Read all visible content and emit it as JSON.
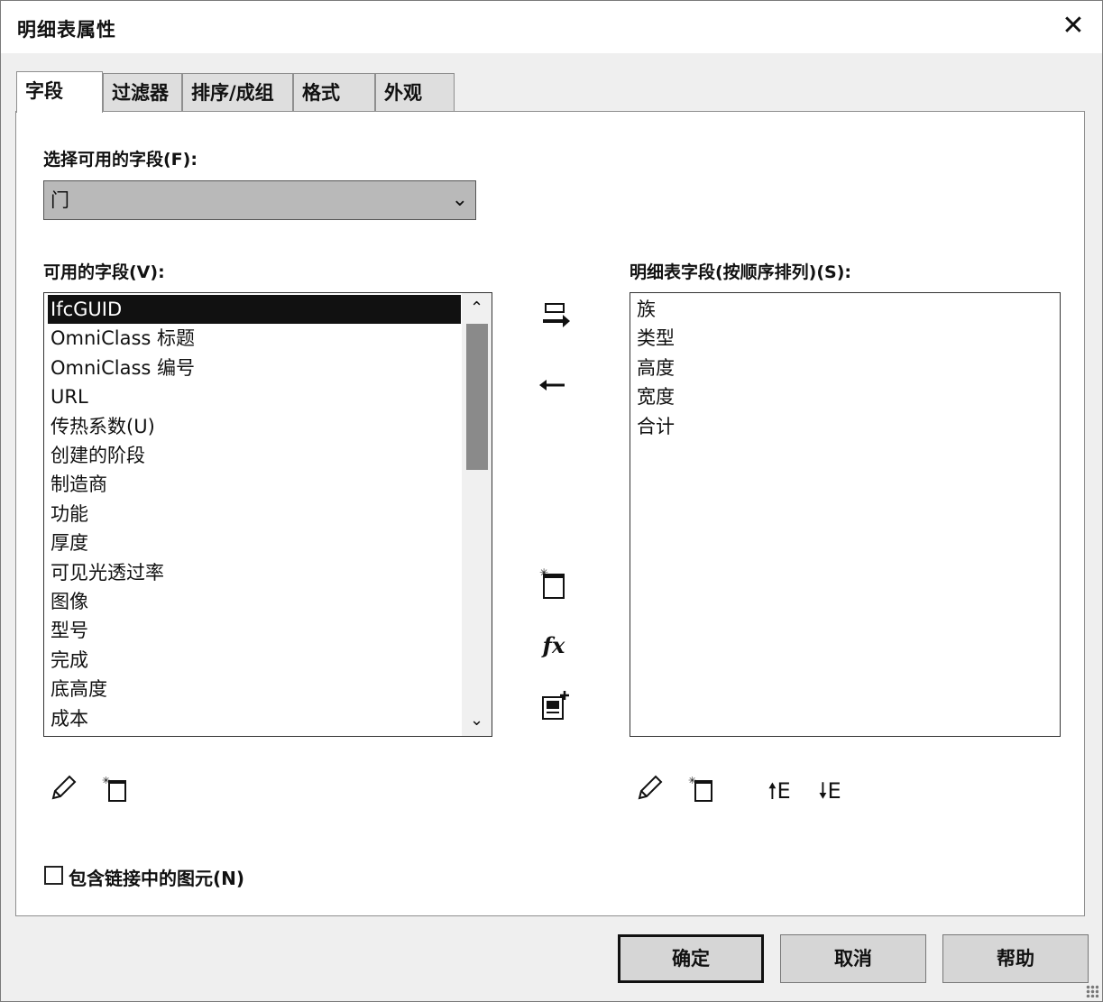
{
  "window": {
    "title": "明细表属性"
  },
  "tabs": [
    {
      "label": "字段"
    },
    {
      "label": "过滤器"
    },
    {
      "label": "排序/成组"
    },
    {
      "label": "格式"
    },
    {
      "label": "外观"
    }
  ],
  "fields_tab": {
    "select_label": "选择可用的字段(F):",
    "select_value": "门",
    "available_label": "可用的字段(V):",
    "available_items": [
      "IfcGUID",
      "OmniClass 标题",
      "OmniClass 编号",
      "URL",
      "传热系数(U)",
      "创建的阶段",
      "制造商",
      "功能",
      "厚度",
      "可见光透过率",
      "图像",
      "型号",
      "完成",
      "底高度",
      "成本"
    ],
    "selected_available_item": "IfcGUID",
    "scheduled_label": "明细表字段(按顺序排列)(S):",
    "scheduled_items": [
      "族",
      "类型",
      "高度",
      "宽度",
      "合计"
    ],
    "include_linked_label": "包含链接中的图元(N)",
    "include_linked_checked": false
  },
  "footer": {
    "ok_label": "确定",
    "cancel_label": "取消",
    "help_label": "帮助"
  },
  "icons": {
    "close": "close-icon",
    "add": "add-parameter-icon",
    "remove": "remove-parameter-icon",
    "new": "new-parameter-icon",
    "formula": "formula-icon",
    "combine": "combine-parameters-icon",
    "edit": "pencil-icon",
    "move_up": "move-up-icon",
    "move_down": "move-down-icon"
  }
}
